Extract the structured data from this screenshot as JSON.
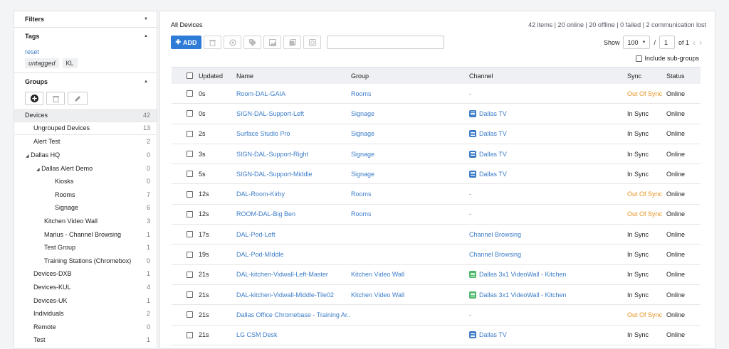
{
  "sidebar": {
    "filters_label": "Filters",
    "tags_label": "Tags",
    "reset_label": "reset",
    "tags": [
      "untagged",
      "KL"
    ],
    "groups_label": "Groups",
    "tree": [
      {
        "label": "Devices",
        "count": "42"
      },
      {
        "label": "Ungrouped Devices",
        "count": "13"
      },
      {
        "label": "Alert Test",
        "count": "2"
      },
      {
        "label": "Dallas HQ",
        "count": "0"
      },
      {
        "label": "Dallas Alert Demo",
        "count": "0"
      },
      {
        "label": "Kiosks",
        "count": "0"
      },
      {
        "label": "Rooms",
        "count": "7"
      },
      {
        "label": "Signage",
        "count": "6"
      },
      {
        "label": "Kitchen Video Wall",
        "count": "3"
      },
      {
        "label": "Marius - Channel Browsing",
        "count": "1"
      },
      {
        "label": "Test Group",
        "count": "1"
      },
      {
        "label": "Training Stations (Chromebox)",
        "count": "0"
      },
      {
        "label": "Devices-DXB",
        "count": "1"
      },
      {
        "label": "Devices-KUL",
        "count": "4"
      },
      {
        "label": "Devices-UK",
        "count": "1"
      },
      {
        "label": "Individuals",
        "count": "2"
      },
      {
        "label": "Remote",
        "count": "0"
      },
      {
        "label": "Test",
        "count": "1"
      }
    ]
  },
  "main": {
    "title": "All Devices",
    "stats": "42 items | 20 online | 20 offline | 0 failed | 2 communication lost",
    "add_label": "ADD",
    "show_label": "Show",
    "page_size": "100",
    "page_sep": "/",
    "page": "1",
    "page_of": "of 1",
    "include_subgroups": "Include sub-groups",
    "columns": {
      "updated": "Updated",
      "name": "Name",
      "group": "Group",
      "channel": "Channel",
      "sync": "Sync",
      "status": "Status"
    },
    "rows": [
      {
        "updated": "0s",
        "name": "Room-DAL-GAIA",
        "group": "Rooms",
        "channel": "-",
        "sync": "Out Of Sync",
        "status": "Online"
      },
      {
        "updated": "0s",
        "name": "SIGN-DAL-Support-Left",
        "group": "Signage",
        "channel": "Dallas TV",
        "sync": "In Sync",
        "status": "Online"
      },
      {
        "updated": "2s",
        "name": "Surface Studio Pro",
        "group": "Signage",
        "channel": "Dallas TV",
        "sync": "In Sync",
        "status": "Online"
      },
      {
        "updated": "3s",
        "name": "SIGN-DAL-Support-Right",
        "group": "Signage",
        "channel": "Dallas TV",
        "sync": "In Sync",
        "status": "Online"
      },
      {
        "updated": "5s",
        "name": "SIGN-DAL-Support-Middle",
        "group": "Signage",
        "channel": "Dallas TV",
        "sync": "In Sync",
        "status": "Online"
      },
      {
        "updated": "12s",
        "name": "DAL-Room-Kirby",
        "group": "Rooms",
        "channel": "-",
        "sync": "Out Of Sync",
        "status": "Online"
      },
      {
        "updated": "12s",
        "name": "ROOM-DAL-Big Ben",
        "group": "Rooms",
        "channel": "-",
        "sync": "Out Of Sync",
        "status": "Online"
      },
      {
        "updated": "17s",
        "name": "DAL-Pod-Left",
        "group": "",
        "channel": "Channel Browsing",
        "sync": "In Sync",
        "status": "Online"
      },
      {
        "updated": "19s",
        "name": "DAL-Pod-MIddle",
        "group": "",
        "channel": "Channel Browsing",
        "sync": "In Sync",
        "status": "Online"
      },
      {
        "updated": "21s",
        "name": "DAL-kitchen-Vidwall-Left-Master",
        "group": "Kitchen Video Wall",
        "channel": "Dallas 3x1 VideoWall - Kitchen",
        "sync": "In Sync",
        "status": "Online"
      },
      {
        "updated": "21s",
        "name": "DAL-kitchen-Vidwall-Middle-Tile02",
        "group": "Kitchen Video Wall",
        "channel": "Dallas 3x1 VideoWall - Kitchen",
        "sync": "In Sync",
        "status": "Online"
      },
      {
        "updated": "21s",
        "name": "Dallas Office Chromebase - Training Ar...",
        "group": "",
        "channel": "-",
        "sync": "Out Of Sync",
        "status": "Online"
      },
      {
        "updated": "21s",
        "name": "LG CSM Desk",
        "group": "",
        "channel": "Dallas TV",
        "sync": "In Sync",
        "status": "Online"
      }
    ]
  },
  "colors": {
    "accent": "#2f7bd8",
    "link": "#3d7dc8",
    "out_of_sync": "#e8931d",
    "videowall_icon": "#4cb86a"
  }
}
